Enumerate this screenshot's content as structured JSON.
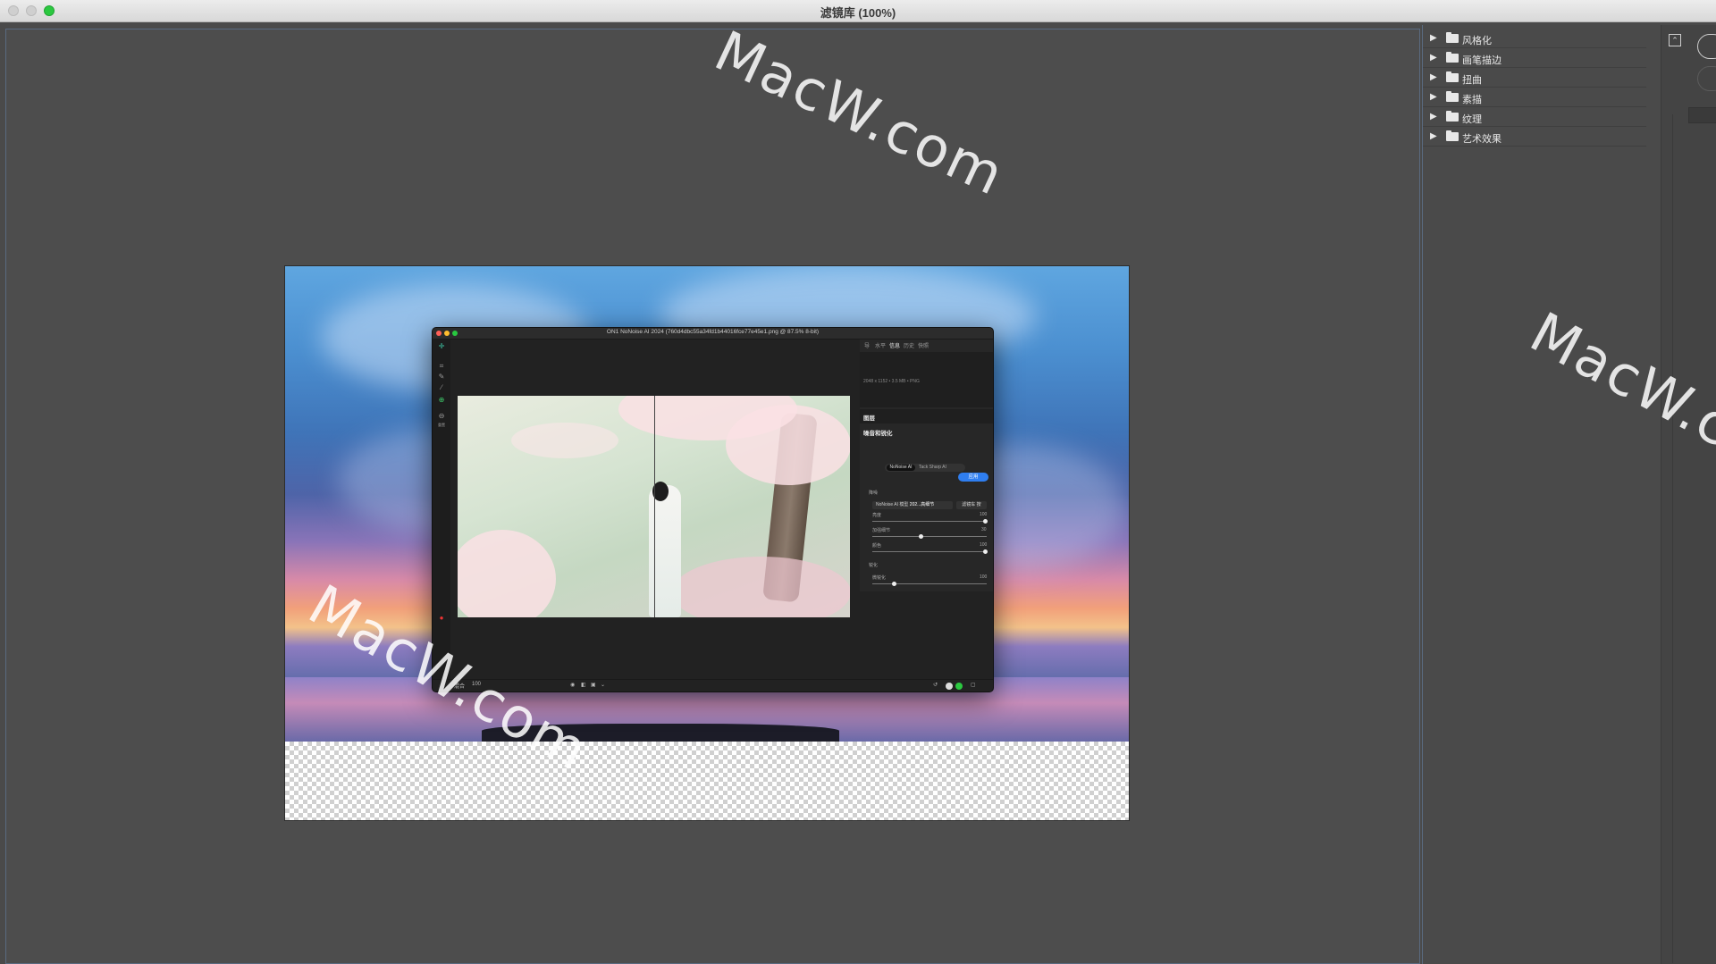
{
  "window": {
    "title": "滤镜库 (100%)"
  },
  "filter_library": {
    "categories": [
      {
        "label": "风格化"
      },
      {
        "label": "画笔描边"
      },
      {
        "label": "扭曲"
      },
      {
        "label": "素描"
      },
      {
        "label": "纹理"
      },
      {
        "label": "艺术效果"
      }
    ]
  },
  "on1": {
    "title": "ON1 NoNoise AI 2024 (760d4dbc55a34fd1b44016fce77e45e1.png @ 87.5% 8-bit)",
    "tabs": [
      "导",
      "水平",
      "信息",
      "历史",
      "快照"
    ],
    "active_tab": "信息",
    "file_info": "2048 x 1152 • 3.5 MB • PNG",
    "layers_heading": "图层",
    "section_heading": "噪音和锐化",
    "mode_tabs": [
      "NoNoise AI",
      "Tack Sharp AI"
    ],
    "apply_button": "应用",
    "denoise_label": "降噪",
    "model_dropdown_label": "NoNoise AI 模型",
    "model_dropdown_value": "202...高细节",
    "filter_button": "滤镜车 按",
    "sliders": [
      {
        "label": "亮度",
        "value": "100",
        "position": 1.0
      },
      {
        "label": "加强细节",
        "value": "30",
        "position": 0.42
      },
      {
        "label": "颜色",
        "value": "100",
        "position": 1.0
      }
    ],
    "sharpen_label": "锐化",
    "sharpen_slider": {
      "label": "微锐化",
      "value": "100",
      "position": 0.18
    },
    "bottom_left_label": "混合",
    "bottom_left_value": "100",
    "tool_label_bottom": "重置"
  },
  "watermarks": [
    "MacW.com",
    "MacW.com",
    "MacW.c"
  ],
  "colors": {
    "accent": "#2f7ef0",
    "maximize": "#2bc840"
  }
}
